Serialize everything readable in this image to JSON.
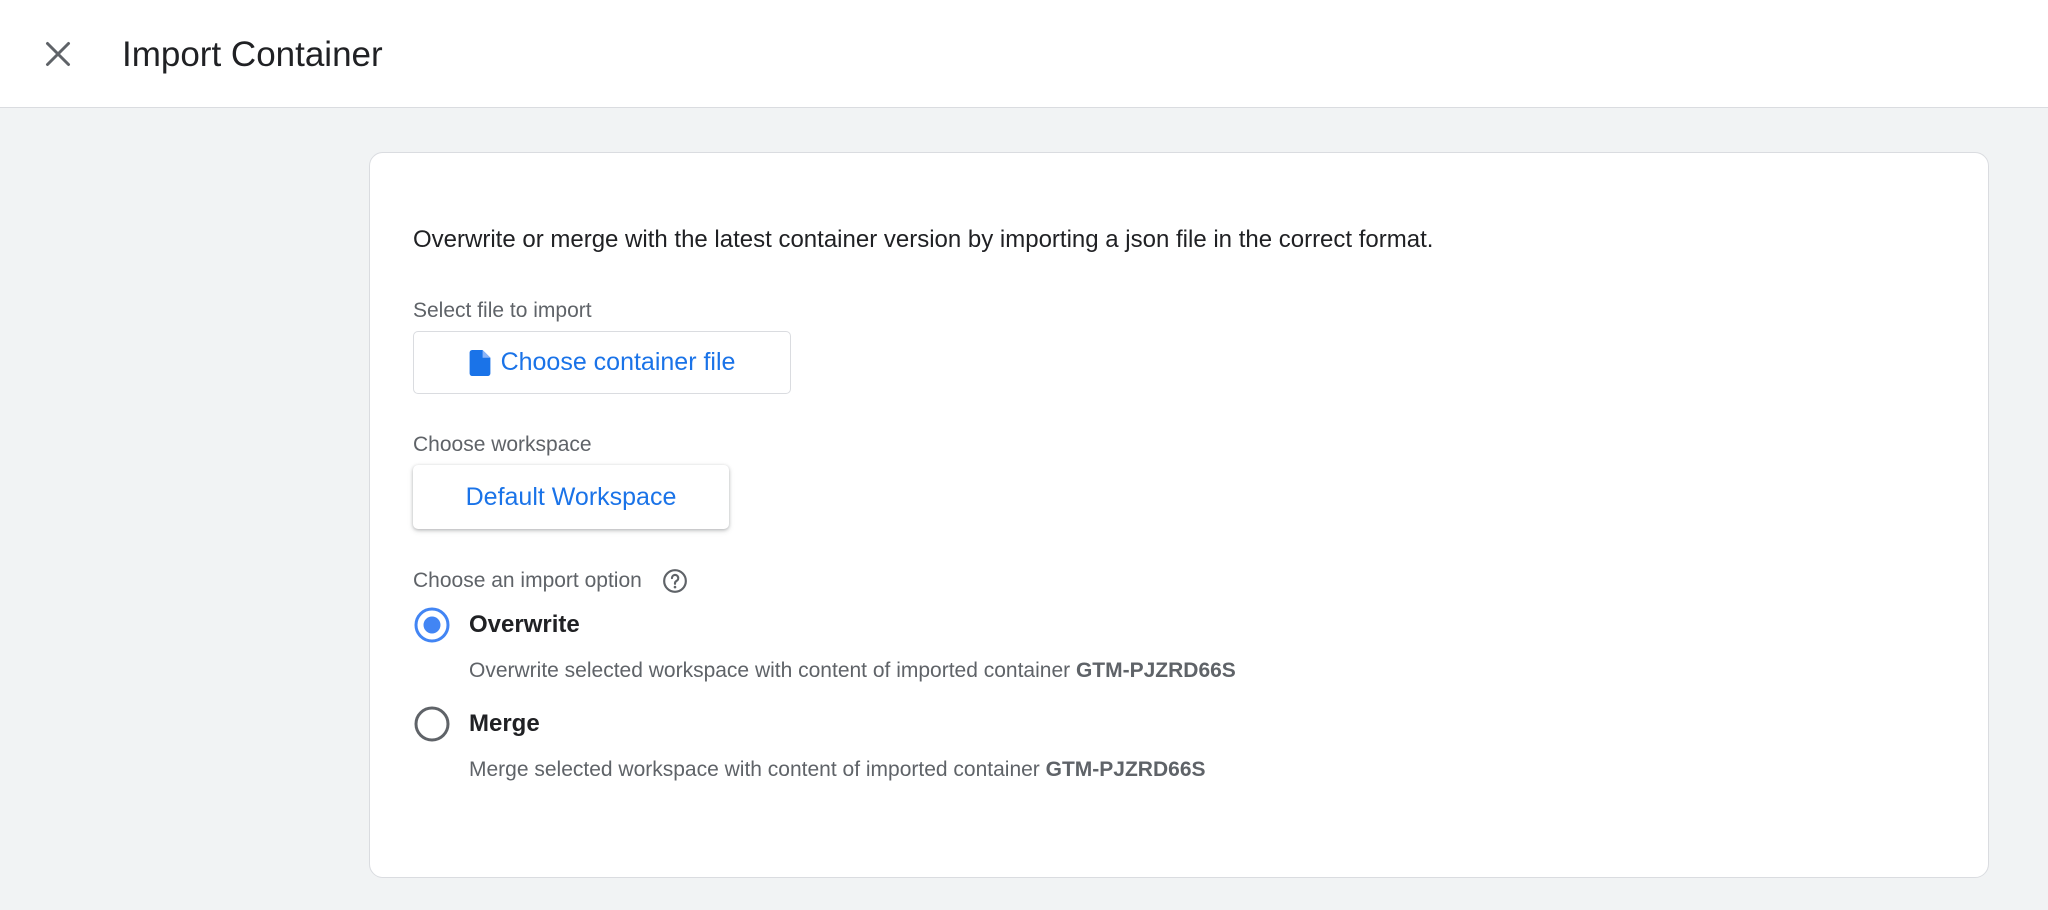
{
  "header": {
    "title": "Import Container",
    "close_icon": "close-icon"
  },
  "card": {
    "description": "Overwrite or merge with the latest container version by importing a json file in the correct format.",
    "file_section": {
      "label": "Select file to import",
      "button_label": "Choose container file",
      "button_icon": "file-icon"
    },
    "workspace_section": {
      "label": "Choose workspace",
      "button_label": "Default Workspace"
    },
    "import_option_section": {
      "label": "Choose an import option",
      "help_icon": "help-circle-icon",
      "options": [
        {
          "label": "Overwrite",
          "description": "Overwrite selected workspace with content of imported container",
          "container_id": "GTM-PJZRD66S",
          "selected": true
        },
        {
          "label": "Merge",
          "description": "Merge selected workspace with content of imported container",
          "container_id": "GTM-PJZRD66S",
          "selected": false
        }
      ]
    }
  },
  "colors": {
    "accent": "#1a73e8",
    "radio_selected": "#4285f4",
    "radio_unselected": "#5f6368",
    "background": "#f1f3f4"
  }
}
